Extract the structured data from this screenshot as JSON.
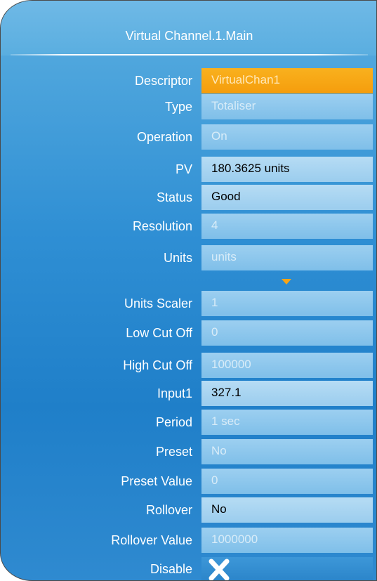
{
  "title": "Virtual Channel.1.Main",
  "rows": [
    {
      "label": "Descriptor",
      "value": "VirtualChan1"
    },
    {
      "label": "Type",
      "value": "Totaliser"
    },
    {
      "label": "Operation",
      "value": "On"
    },
    {
      "label": "PV",
      "value": "180.3625 units"
    },
    {
      "label": "Status",
      "value": "Good"
    },
    {
      "label": "Resolution",
      "value": "4"
    },
    {
      "label": "Units",
      "value": "units"
    },
    {
      "label": "Units Scaler",
      "value": "1"
    },
    {
      "label": "Low Cut Off",
      "value": "0"
    },
    {
      "label": "High Cut Off",
      "value": "100000"
    },
    {
      "label": "Input1",
      "value": "327.1"
    },
    {
      "label": "Period",
      "value": "1 sec"
    },
    {
      "label": "Preset",
      "value": "No"
    },
    {
      "label": "Preset Value",
      "value": "0"
    },
    {
      "label": "Rollover",
      "value": "No"
    },
    {
      "label": "Rollover Value",
      "value": "1000000"
    },
    {
      "label": "Disable",
      "value": ""
    }
  ],
  "colors": {
    "panel_blue": "#2f8fd4",
    "field_blue": "#9ccff0",
    "selected_orange": "#f7a416"
  },
  "icons": {
    "scroll": "triangle-down-icon",
    "disable": "cross-checkbox-icon"
  }
}
